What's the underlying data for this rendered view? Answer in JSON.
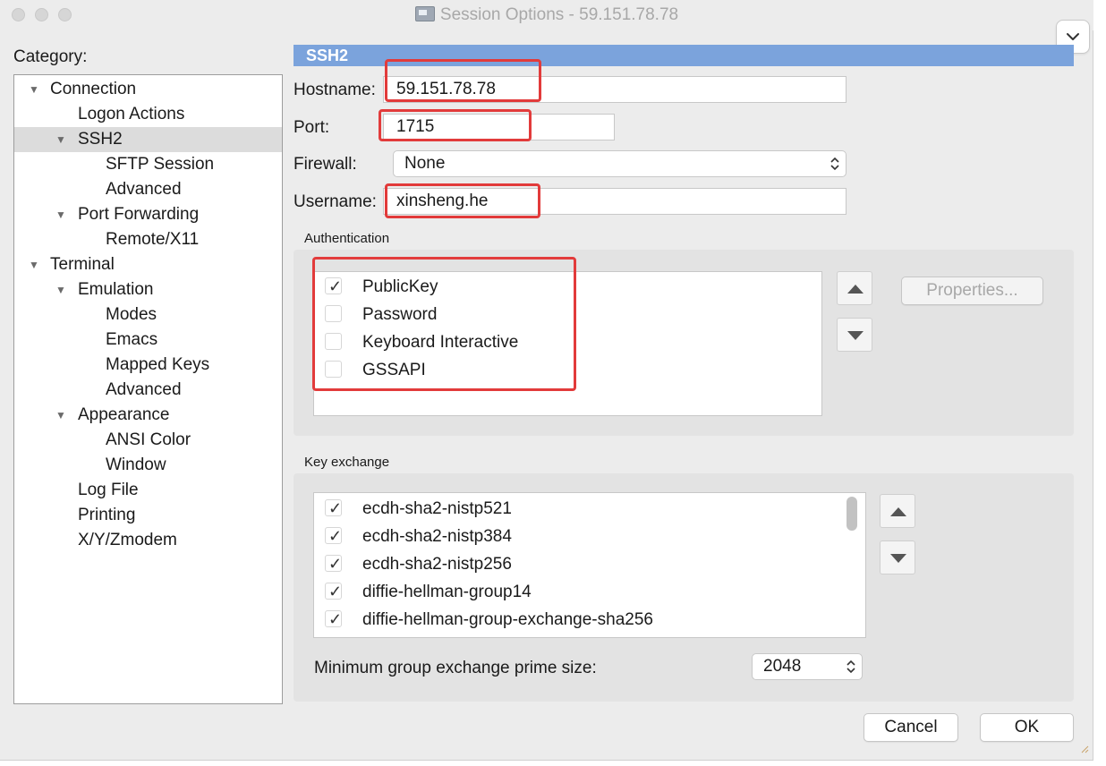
{
  "window": {
    "title": "Session Options - 59.151.78.78"
  },
  "category": {
    "label": "Category:",
    "items": [
      {
        "label": "Connection",
        "level": 0,
        "expanded": true
      },
      {
        "label": "Logon Actions",
        "level": 1
      },
      {
        "label": "SSH2",
        "level": 1,
        "expanded": true,
        "selected": true
      },
      {
        "label": "SFTP Session",
        "level": 2
      },
      {
        "label": "Advanced",
        "level": 2
      },
      {
        "label": "Port Forwarding",
        "level": 1,
        "expanded": true
      },
      {
        "label": "Remote/X11",
        "level": 2
      },
      {
        "label": "Terminal",
        "level": 0,
        "expanded": true
      },
      {
        "label": "Emulation",
        "level": 1,
        "expanded": true
      },
      {
        "label": "Modes",
        "level": 2
      },
      {
        "label": "Emacs",
        "level": 2
      },
      {
        "label": "Mapped Keys",
        "level": 2
      },
      {
        "label": "Advanced",
        "level": 2
      },
      {
        "label": "Appearance",
        "level": 1,
        "expanded": true
      },
      {
        "label": "ANSI Color",
        "level": 2
      },
      {
        "label": "Window",
        "level": 2
      },
      {
        "label": "Log File",
        "level": 1
      },
      {
        "label": "Printing",
        "level": 1
      },
      {
        "label": "X/Y/Zmodem",
        "level": 1
      }
    ]
  },
  "ssh2": {
    "header": "SSH2",
    "hostname": {
      "label": "Hostname:",
      "value": "59.151.78.78"
    },
    "port": {
      "label": "Port:",
      "value": "1715"
    },
    "firewall": {
      "label": "Firewall:",
      "value": "None"
    },
    "username": {
      "label": "Username:",
      "value": "xinsheng.he"
    }
  },
  "authentication": {
    "title": "Authentication",
    "methods": [
      {
        "label": "PublicKey",
        "checked": true
      },
      {
        "label": "Password",
        "checked": false
      },
      {
        "label": "Keyboard Interactive",
        "checked": false
      },
      {
        "label": "GSSAPI",
        "checked": false
      }
    ],
    "properties_button": "Properties..."
  },
  "key_exchange": {
    "title": "Key exchange",
    "algorithms": [
      {
        "label": "ecdh-sha2-nistp521",
        "checked": true
      },
      {
        "label": "ecdh-sha2-nistp384",
        "checked": true
      },
      {
        "label": "ecdh-sha2-nistp256",
        "checked": true
      },
      {
        "label": "diffie-hellman-group14",
        "checked": true
      },
      {
        "label": "diffie-hellman-group-exchange-sha256",
        "checked": true
      }
    ],
    "min_prime_label": "Minimum group exchange prime size:",
    "min_prime_value": "2048"
  },
  "buttons": {
    "cancel": "Cancel",
    "ok": "OK"
  },
  "colors": {
    "section_header": "#7ba3dc",
    "highlight": "#e23b3b",
    "selected_row": "#dcdcdc"
  }
}
